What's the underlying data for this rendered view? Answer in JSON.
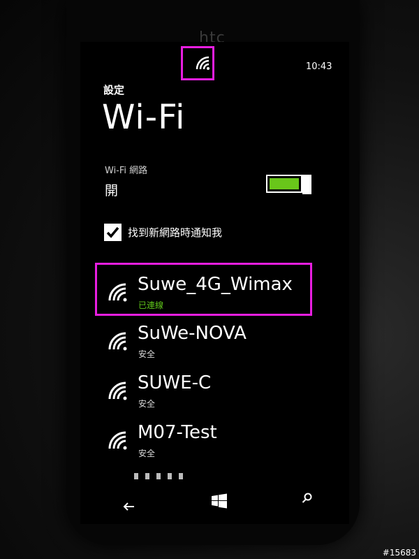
{
  "status_bar": {
    "time": "10:43",
    "wifi_icon": "wifi-icon"
  },
  "header": {
    "breadcrumb": "設定",
    "title": "Wi-Fi"
  },
  "wifi_toggle": {
    "label": "Wi-Fi 網路",
    "value": "開",
    "state": "on",
    "accent": "#69c61a"
  },
  "notify_option": {
    "checked": true,
    "label": "找到新網路時通知我"
  },
  "networks": [
    {
      "name": "Suwe_4G_Wimax",
      "status": "已連線",
      "connected": true
    },
    {
      "name": "SuWe-NOVA",
      "status": "安全",
      "connected": false
    },
    {
      "name": "SUWE-C",
      "status": "安全",
      "connected": false
    },
    {
      "name": "M07-Test",
      "status": "安全",
      "connected": false
    }
  ],
  "nav_bar": {
    "back_icon": "back-arrow-icon",
    "start_icon": "windows-logo-icon",
    "search_icon": "search-icon"
  },
  "colors": {
    "highlight": "#e81ee0",
    "connected": "#5fc61a",
    "background": "#000000"
  },
  "watermark": "#15683",
  "brand": "htc"
}
